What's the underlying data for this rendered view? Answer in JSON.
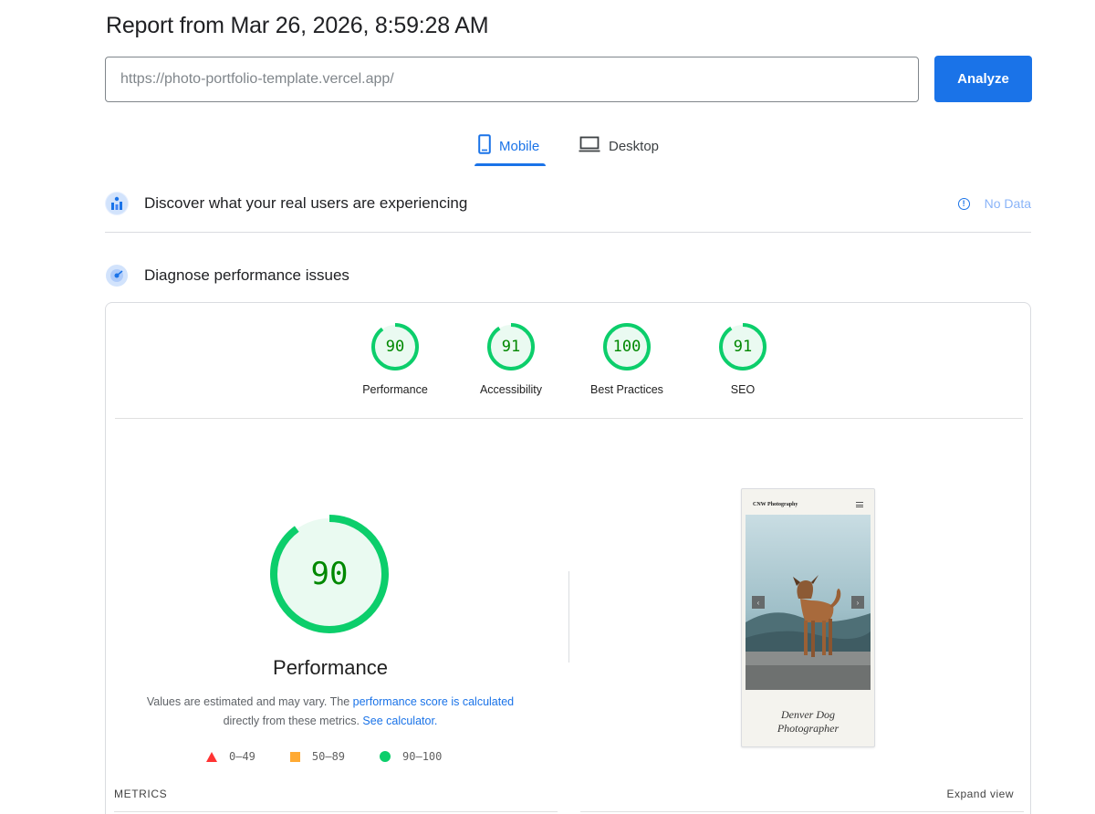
{
  "header": {
    "title": "Report from Mar 26, 2026, 8:59:28 AM"
  },
  "url_bar": {
    "placeholder": "https://photo-portfolio-template.vercel.app/",
    "analyze_label": "Analyze"
  },
  "device_tabs": [
    {
      "label": "Mobile",
      "icon": "phone-icon",
      "selected": true
    },
    {
      "label": "Desktop",
      "icon": "laptop-icon",
      "selected": false
    }
  ],
  "discover": {
    "heading": "Discover what your real users are experiencing",
    "status": "No Data",
    "icon": "field-data-icon"
  },
  "diagnose": {
    "heading": "Diagnose performance issues",
    "icon": "lab-data-icon"
  },
  "scores": [
    {
      "label": "Performance",
      "value": 90
    },
    {
      "label": "Accessibility",
      "value": 91
    },
    {
      "label": "Best Practices",
      "value": 100
    },
    {
      "label": "SEO",
      "value": 91
    }
  ],
  "performance": {
    "score": 90,
    "title": "Performance",
    "desc_part1": "Values are estimated and may vary. The ",
    "desc_link1": "performance score is calculated",
    "desc_part2": " directly from these metrics. ",
    "desc_link2": "See calculator."
  },
  "legend": [
    {
      "range": "0–49",
      "shape": "triangle",
      "color": "#ff3333"
    },
    {
      "range": "50–89",
      "shape": "square",
      "color": "#ffaa33"
    },
    {
      "range": "90–100",
      "shape": "circle",
      "color": "#0cce6b"
    }
  ],
  "screenshot": {
    "site_name": "CNW Photography",
    "caption_line1": "Denver Dog",
    "caption_line2": "Photographer"
  },
  "metrics": {
    "label": "METRICS",
    "expand_label": "Expand view"
  },
  "colors": {
    "accent": "#1a73e8",
    "pass": "#0cce6b",
    "pass_text": "#008800",
    "pass_fill": "#eafaf1"
  }
}
